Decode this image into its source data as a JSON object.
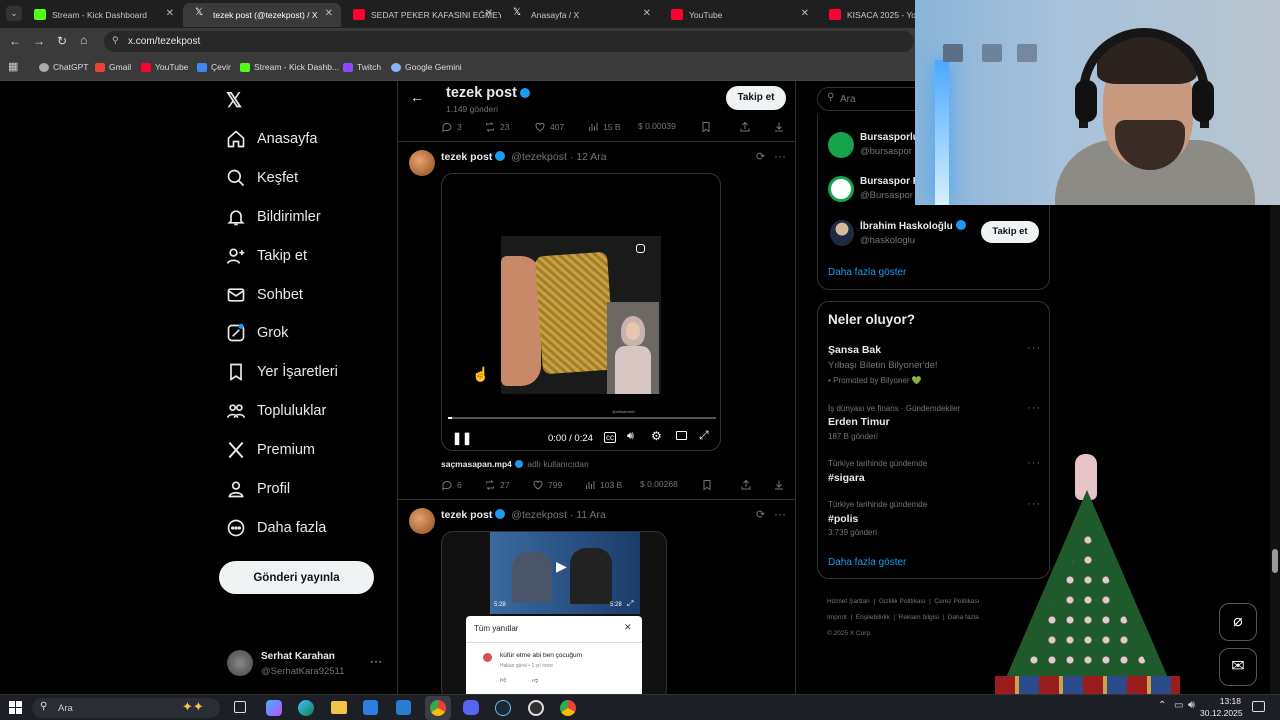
{
  "tabs": [
    {
      "title": "Stream - Kick Dashboard",
      "color": "#53fc18"
    },
    {
      "title": "tezek post (@tezekpost) / X",
      "color": "#ffffff"
    },
    {
      "title": "SEDAT PEKER KAFASINI EĞMEY",
      "color": "#ff0033"
    },
    {
      "title": "Anasayfa / X",
      "color": "#ffffff"
    },
    {
      "title": "YouTube",
      "color": "#ff0033"
    },
    {
      "title": "KISACA 2025 - YouT",
      "color": "#ff0033"
    }
  ],
  "url": "x.com/tezekpost",
  "bookmarks": [
    "ChatGPT",
    "Gmail",
    "YouTube",
    "Çevir",
    "Stream - Kick Dashb...",
    "Twitch",
    "Google Gemini"
  ],
  "nav": {
    "items": [
      "Anasayfa",
      "Keşfet",
      "Bildirimler",
      "Takip et",
      "Sohbet",
      "Grok",
      "Yer İşaretleri",
      "Topluluklar",
      "Premium",
      "Profil",
      "Daha fazla"
    ],
    "post_button": "Gönderi yayınla",
    "user_name": "Serhat Karahan",
    "user_handle": "@SerhatKara92511"
  },
  "header": {
    "name": "tezek post",
    "count": "1.149 gönderi",
    "follow": "Takip et"
  },
  "top_actions": {
    "replies": "3",
    "reposts": "23",
    "likes": "407",
    "views": "15 B",
    "tip": "$ 0.00039"
  },
  "post1": {
    "name": "tezek post",
    "handle": "@tezekpost",
    "time": "· 12 Ara",
    "video_time": "0:00 / 0:24",
    "video_overlay": "@elifsamerin",
    "file_label": "saçmasapan.mp4",
    "file_source": "adlı kullanıcıdan",
    "replies": "6",
    "reposts": "27",
    "likes": "799",
    "views": "103 B",
    "tip": "$ 0.00268"
  },
  "post2": {
    "name": "tezek post",
    "handle": "@tezekpost",
    "time": "· 11 Ara",
    "video_elapsed": "5:28",
    "video_total": "5:28",
    "popup_title": "Tüm yanıtlar",
    "comment": "küfür etme abi ben çocuğum",
    "comment_meta": "Hakan gürel • 1 yıl önce"
  },
  "search": {
    "placeholder": "Ara"
  },
  "who_to_follow": [
    {
      "name": "Bursasporlu",
      "handle": "@bursaspor"
    },
    {
      "name": "Bursaspor H",
      "handle": "@Bursaspor"
    },
    {
      "name": "İbrahim Haskoloğlu",
      "handle": "@haskologlu",
      "button": "Takip et"
    }
  ],
  "show_more": "Daha fazla göster",
  "trends": {
    "title": "Neler oluyor?",
    "items": [
      {
        "name": "Şansa Bak",
        "sub": "Yılbaşı Biletin Bilyoner'de!",
        "meta": "Promoted by Bilyoner 💚"
      },
      {
        "context": "İş dünyası ve finans · Gündemdekiler",
        "name": "Erden Timur",
        "meta": "187 B gönderi"
      },
      {
        "context": "Türkiye tarihinde gündemde",
        "name": "#sigara",
        "meta": ""
      },
      {
        "context": "Türkiye tarihinde gündemde",
        "name": "#polis",
        "meta": "3.739 gönderi"
      }
    ],
    "show_more": "Daha fazla göster"
  },
  "footer": [
    "Hizmet Şartları",
    "Gizlilik Politikası",
    "Çerez Politikası",
    "Imprint",
    "Erişilebilirlik",
    "Reklam bilgisi",
    "Daha fazla",
    "© 2025 X Corp."
  ],
  "taskbar": {
    "search": "Ara",
    "time": "13:18",
    "date": "30.12.2025"
  },
  "colors": {
    "accent": "#1d9bf0",
    "background": "#000000",
    "border": "#2f3336",
    "muted": "#71767b"
  }
}
